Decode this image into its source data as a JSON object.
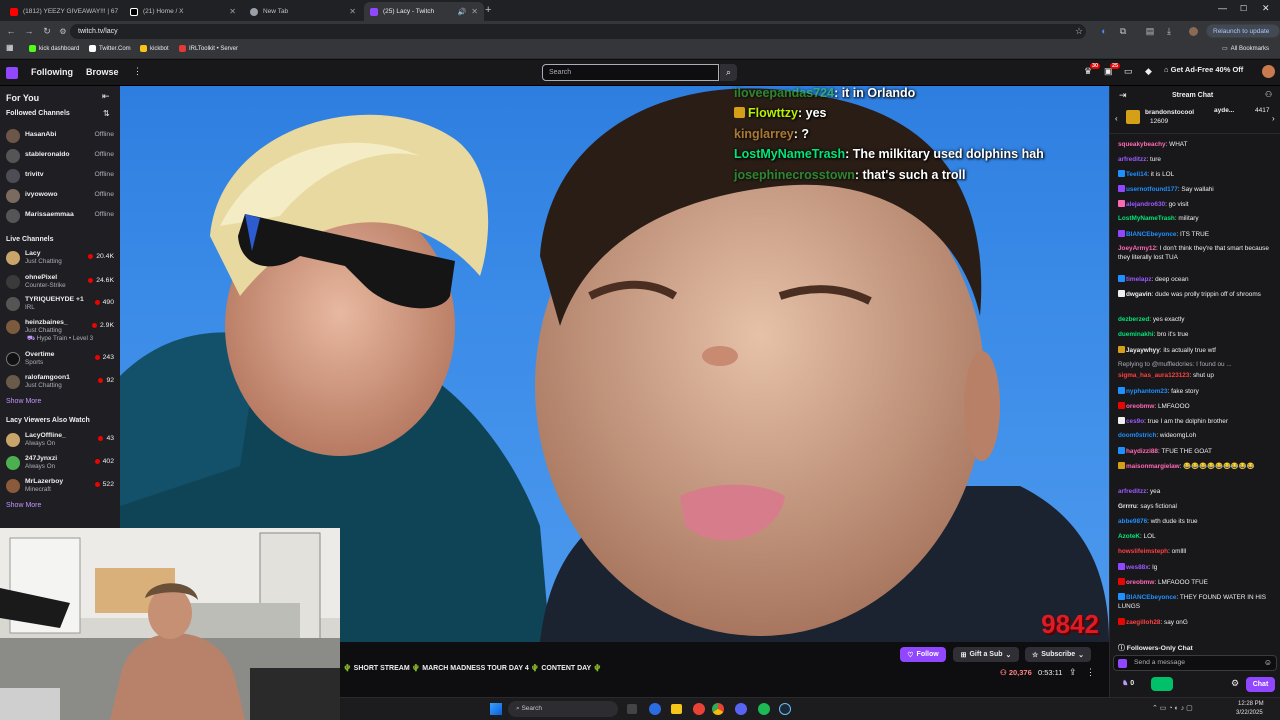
{
  "browser": {
    "tabs": [
      {
        "title": "(1812) YEEZY GIVEAWAY!!! | 67",
        "color": "#ff0000"
      },
      {
        "title": "(21) Home / X",
        "color": "#ffffff"
      },
      {
        "title": "New Tab",
        "color": "#9aa0a6"
      },
      {
        "title": "(25) Lacy - Twitch",
        "color": "#9146ff"
      }
    ],
    "url": "twitch.tv/lacy",
    "relaunch_label": "Relaunch to update",
    "bookmarks": [
      {
        "label": "kick dashboard",
        "color": "#53fc18"
      },
      {
        "label": "Twitter.Com",
        "color": "#ffffff"
      },
      {
        "label": "kickbot",
        "color": "#f5c518"
      },
      {
        "label": "IRLToolkit • Server",
        "color": "#e53935"
      }
    ],
    "all_bookmarks": "All Bookmarks"
  },
  "topnav": {
    "following": "Following",
    "browse": "Browse",
    "search_placeholder": "Search",
    "notif_count_1": "30",
    "notif_count_2": "25",
    "ad_free": "Get Ad-Free 40% Off"
  },
  "sidebar": {
    "for_you": "For You",
    "followed_title": "Followed Channels",
    "followed": [
      {
        "name": "HasanAbi",
        "status": "Offline"
      },
      {
        "name": "stableronaldo",
        "status": "Offline"
      },
      {
        "name": "trivitv",
        "status": "Offline"
      },
      {
        "name": "ivyowowo",
        "status": "Offline"
      },
      {
        "name": "Marissaemmaa",
        "status": "Offline"
      }
    ],
    "live_title": "Live Channels",
    "live": [
      {
        "name": "Lacy",
        "category": "Just Chatting",
        "viewers": "20.4K"
      },
      {
        "name": "ohnePixel",
        "category": "Counter-Strike",
        "viewers": "24.6K"
      },
      {
        "name": "TYRIQUEHYDE +1",
        "category": "IRL",
        "viewers": "490"
      },
      {
        "name": "heinzbaines_",
        "category": "Just Chatting",
        "viewers": "2.9K",
        "extra": "Hype Train • Level 3"
      },
      {
        "name": "Overtime",
        "category": "Sports",
        "viewers": "243"
      },
      {
        "name": "ralofamgoon1",
        "category": "Just Chatting",
        "viewers": "92"
      }
    ],
    "show_more": "Show More",
    "also_title": "Lacy Viewers Also Watch",
    "also": [
      {
        "name": "LacyOffline_",
        "category": "Always On",
        "viewers": "43"
      },
      {
        "name": "247Jynxzi",
        "category": "Always On",
        "viewers": "402"
      },
      {
        "name": "MrLazerboy",
        "category": "Minecraft",
        "viewers": "522"
      }
    ],
    "show_more_2": "Show More"
  },
  "video": {
    "overlay_chat": [
      {
        "user": "iloveepandas724",
        "text": ": it in Orlando",
        "color": "#2ecc40"
      },
      {
        "user": "Flowttzy",
        "text": ": yes",
        "color": "#b8f000"
      },
      {
        "user": "kinglarrey",
        "text": ": ?",
        "color": "#e0a040"
      },
      {
        "user": "LostMyNameTrash",
        "text": ": The milkitary used dolphins hah",
        "color": "#00e676"
      },
      {
        "user": "josephinecrosstown",
        "text": ": that's such a troll",
        "color": "#2ecc40"
      }
    ],
    "counter": "9842"
  },
  "stream_info": {
    "title": "🌵 SHORT STREAM 🌵 MARCH MADNESS TOUR DAY 4 🌵 CONTENT DAY 🌵",
    "follow": "Follow",
    "gift": "Gift a Sub",
    "subscribe": "Subscribe",
    "viewers": "20,376",
    "uptime": "0:53:11"
  },
  "chat": {
    "header": "Stream Chat",
    "pinned_user": "brandonstocool",
    "pinned_amount": "12609",
    "pinned_user2": "ayde...",
    "pinned_amount2": "4417",
    "messages": [
      {
        "user": "squeakybeachy",
        "text": ": WHAT",
        "color": "#ff69b4"
      },
      {
        "user": "arfreditzz",
        "text": ": ture",
        "color": "#9b59ff"
      },
      {
        "user": "Teeli14",
        "text": ": it is LOL",
        "color": "#1e90ff"
      },
      {
        "user": "usernotfound177",
        "text": ": Say wallahi",
        "color": "#1e90ff"
      },
      {
        "user": "alejandro630",
        "text": ": go visit",
        "color": "#9b59ff"
      },
      {
        "user": "LostMyNameTrash",
        "text": ": military",
        "color": "#00e676"
      },
      {
        "user": "BIANCEbeyonce",
        "text": ": ITS TRUE",
        "color": "#1e90ff"
      },
      {
        "user": "JoeyArmy12",
        "text": ": I don't think they're that smart because they literally lost TUA",
        "color": "#ff69b4"
      },
      {
        "user": "timelapz",
        "text": ": deep ocean",
        "color": "#9b59ff"
      },
      {
        "user": "dwgavin",
        "text": ": dude was prolly trippin off of shrooms",
        "color": "#efeff1"
      },
      {
        "user": "dezberzed",
        "text": ": yes exactly",
        "color": "#00e676"
      },
      {
        "user": "dueminakhi",
        "text": ": bro it's true",
        "color": "#00e676"
      },
      {
        "user": "Jayaywhyy",
        "text": ": its actually true wtf",
        "color": "#efeff1"
      },
      {
        "user": "",
        "text": "Replying to @muffledcries: I found ou ...",
        "color": "#adadb8"
      },
      {
        "user": "sigma_has_aura123123",
        "text": ": shut up",
        "color": "#ff4040"
      },
      {
        "user": "nyphantom23",
        "text": ": fake story",
        "color": "#1e90ff"
      },
      {
        "user": "oreobmw",
        "text": ": LMFAOOO",
        "color": "#ff69b4"
      },
      {
        "user": "ces9o",
        "text": ": true I am the dolphin brother",
        "color": "#9b59ff"
      },
      {
        "user": "doom0strich",
        "text": ": wideomgLoh",
        "color": "#1e90ff"
      },
      {
        "user": "haydizzi88",
        "text": ": TFUE THE GOAT",
        "color": "#ff69b4"
      },
      {
        "user": "maisonmargielaw",
        "text": ": 😂😂😂😂😂😂😂😂😂",
        "color": "#ff69b4"
      },
      {
        "user": "arfreditzz",
        "text": ": yea",
        "color": "#9b59ff"
      },
      {
        "user": "Grrrru",
        "text": ": says fictional",
        "color": "#efeff1"
      },
      {
        "user": "abbe9876",
        "text": ": wth dude its true",
        "color": "#1e90ff"
      },
      {
        "user": "AzoteK",
        "text": ": LOL",
        "color": "#00e676"
      },
      {
        "user": "howslifeimsteph",
        "text": ": omllll",
        "color": "#ff4040"
      },
      {
        "user": "wes88x",
        "text": ": lg",
        "color": "#9b59ff"
      },
      {
        "user": "oreobmw",
        "text": ": LMFAOOO TFUE",
        "color": "#ff69b4"
      },
      {
        "user": "BIANCEbeyonce",
        "text": ": THEY FOUND WATER IN HIS LUNGS",
        "color": "#1e90ff"
      },
      {
        "user": "zaegilloh28",
        "text": ": say onG",
        "color": "#ff4040"
      }
    ],
    "followers_only": "Followers-Only Chat",
    "input_placeholder": "Send a message",
    "points": "0",
    "chat_button": "Chat"
  },
  "taskbar": {
    "search": "Search",
    "time": "12:28 PM",
    "date": "3/22/2025"
  }
}
